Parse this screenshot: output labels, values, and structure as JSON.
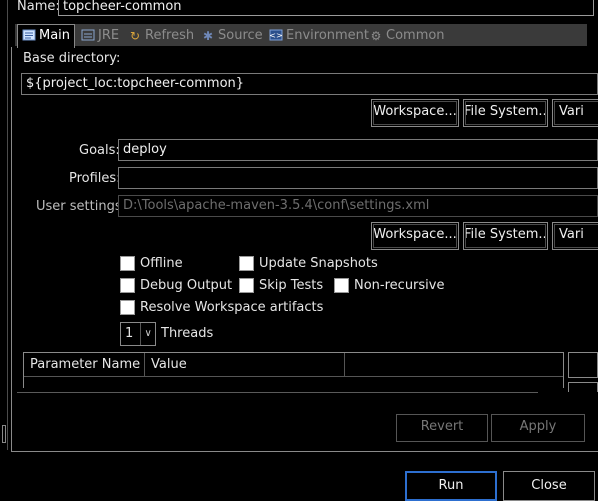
{
  "name_label": "Name:",
  "name_value": "topcheer-common",
  "tabs": [
    {
      "label": "Main",
      "icon": "main-tab-icon"
    },
    {
      "label": "JRE",
      "icon": "jre-icon"
    },
    {
      "label": "Refresh",
      "icon": "refresh-icon"
    },
    {
      "label": "Source",
      "icon": "source-icon"
    },
    {
      "label": "Environment",
      "icon": "environment-icon"
    },
    {
      "label": "Common",
      "icon": "common-icon"
    }
  ],
  "base_dir": {
    "label": "Base directory:",
    "value": "${project_loc:topcheer-common}",
    "workspace_btn": "Workspace...",
    "filesystem_btn": "File System...",
    "variables_btn": "Vari"
  },
  "goals": {
    "label": "Goals:",
    "value": "deploy"
  },
  "profiles": {
    "label": "Profiles:",
    "value": ""
  },
  "user_settings": {
    "label": "User settings:",
    "value": "D:\\Tools\\apache-maven-3.5.4\\conf\\settings.xml",
    "workspace_btn": "Workspace...",
    "filesystem_btn": "File System...",
    "variables_btn": "Vari"
  },
  "options": {
    "offline": "Offline",
    "update_snapshots": "Update Snapshots",
    "debug_output": "Debug Output",
    "skip_tests": "Skip Tests",
    "non_recursive": "Non-recursive",
    "resolve_workspace": "Resolve Workspace artifacts"
  },
  "threads": {
    "value": "1",
    "label": "Threads"
  },
  "table": {
    "col_param": "Parameter Name",
    "col_value": "Value"
  },
  "buttons": {
    "revert": "Revert",
    "apply": "Apply",
    "run": "Run",
    "close": "Close"
  }
}
